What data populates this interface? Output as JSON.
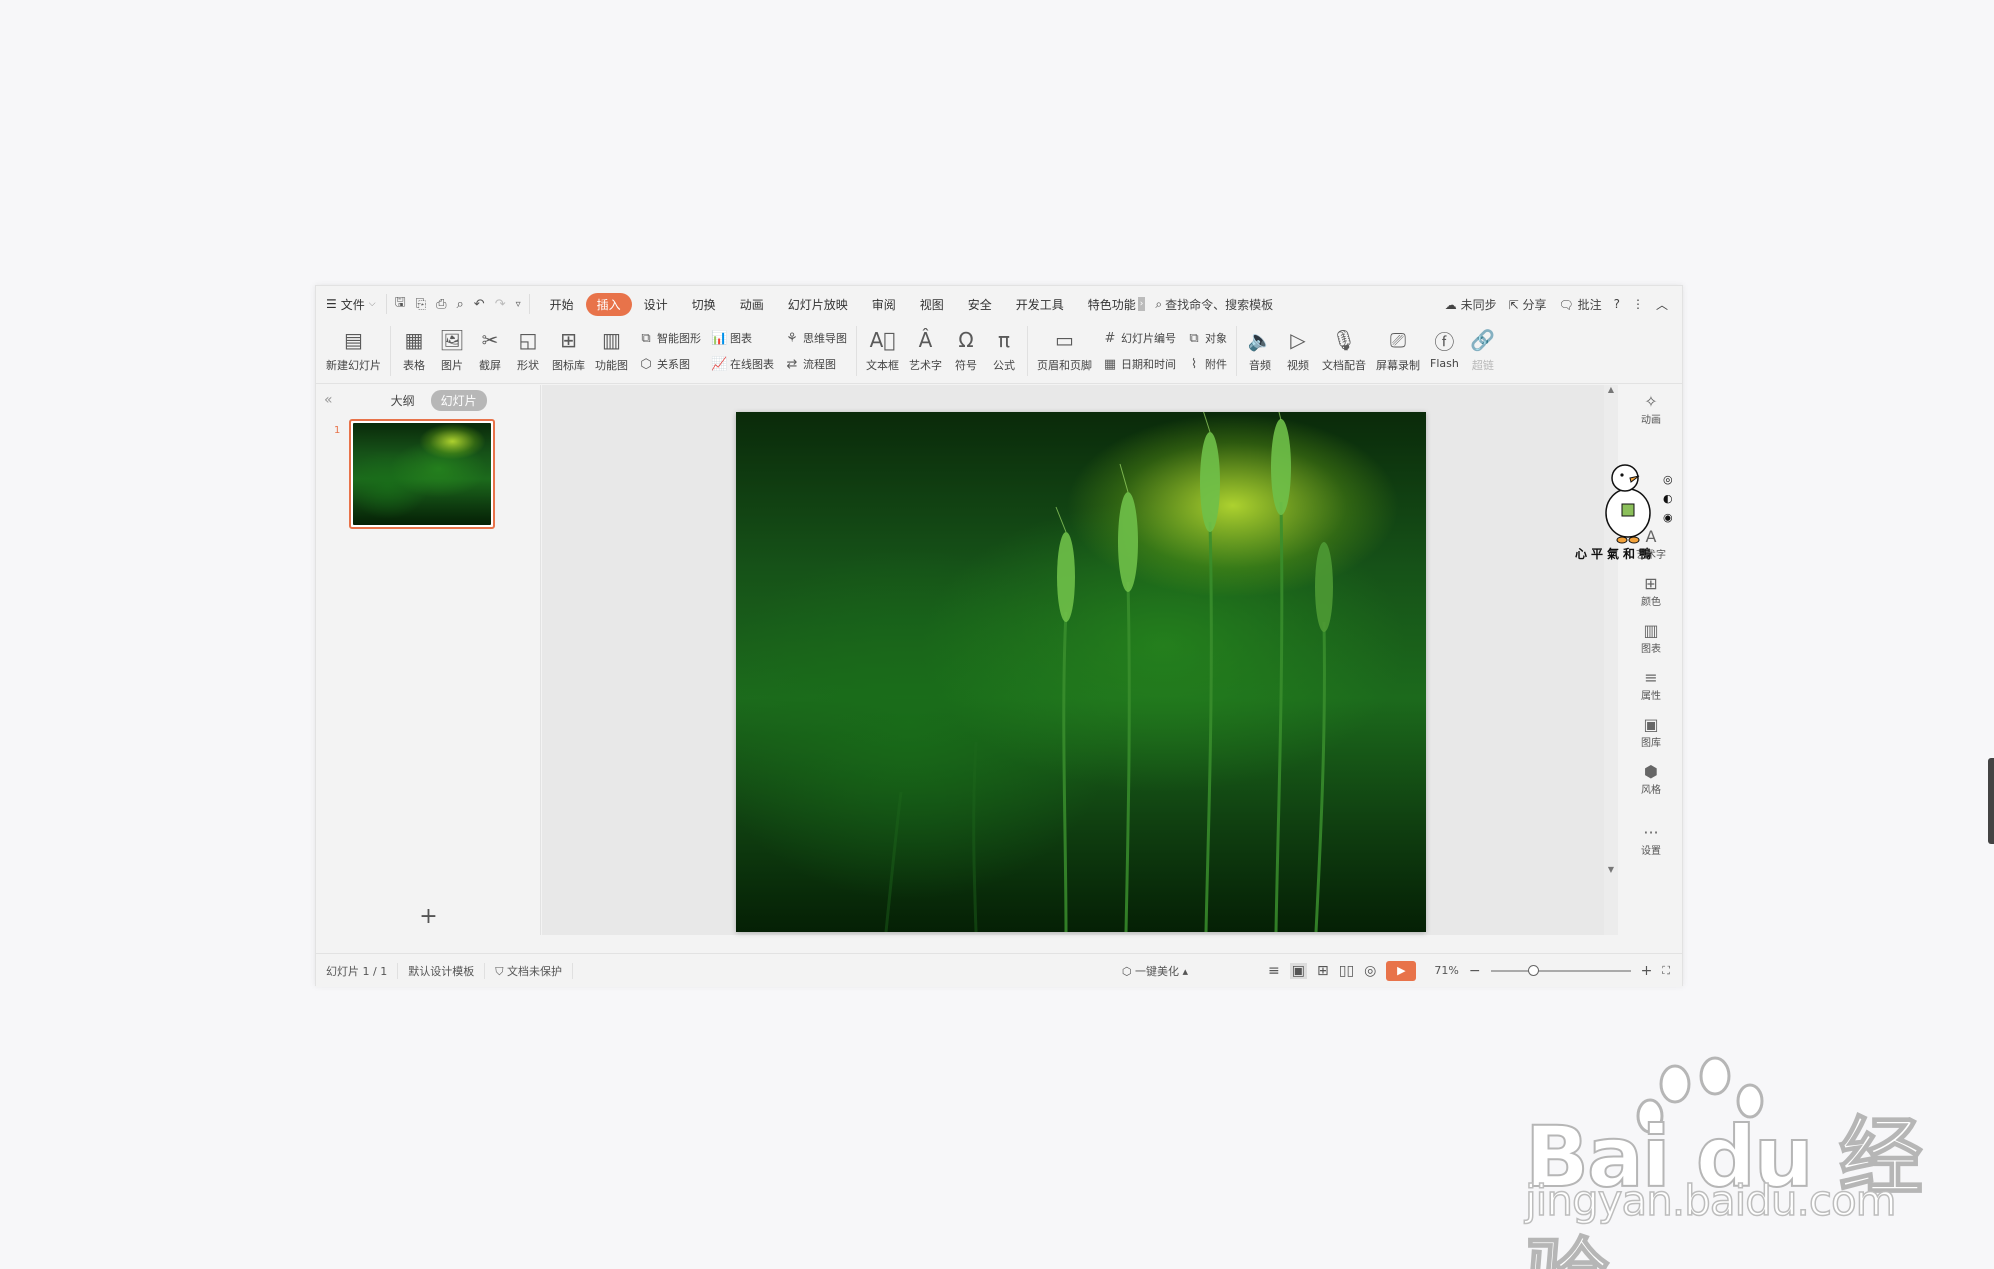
{
  "menubar": {
    "file": "文件",
    "tabs": [
      "开始",
      "插入",
      "设计",
      "切换",
      "动画",
      "幻灯片放映",
      "审阅",
      "视图",
      "安全",
      "开发工具",
      "特色功能"
    ],
    "active_tab": "插入",
    "search": "查找命令、搜索模板",
    "sync": "未同步",
    "share": "分享",
    "comment": "批注",
    "help": "?"
  },
  "ribbon": {
    "new_slide": "新建幻灯片",
    "table": "表格",
    "picture": "图片",
    "screenshot": "截屏",
    "shape": "形状",
    "icon_lib": "图标库",
    "func_chart": "功能图",
    "smart_art": "智能图形",
    "relation": "关系图",
    "chart": "图表",
    "online_chart": "在线图表",
    "mind_map": "思维导图",
    "flow_chart": "流程图",
    "textbox": "文本框",
    "wordart": "艺术字",
    "symbol": "符号",
    "formula": "公式",
    "header_footer": "页眉和页脚",
    "slide_number": "幻灯片编号",
    "date_time": "日期和时间",
    "object": "对象",
    "attachment": "附件",
    "audio": "音频",
    "video": "视频",
    "doc_voice": "文档配音",
    "screen_record": "屏幕录制",
    "flash": "Flash",
    "hyperlink": "超链"
  },
  "left_pane": {
    "tab_outline": "大纲",
    "tab_slides": "幻灯片",
    "slide_number": "1",
    "add": "+"
  },
  "sidebar": {
    "items": [
      "动画",
      "艺术字",
      "颜色",
      "图表",
      "属性",
      "图库",
      "风格",
      "设置"
    ]
  },
  "status": {
    "slide_info": "幻灯片 1 / 1",
    "template": "默认设计模板",
    "protection": "文档未保护",
    "beautify": "一键美化",
    "zoom": "71%",
    "zoom_level": 0.3
  },
  "mascot": {
    "caption": "心平氣和鴨"
  },
  "watermark": {
    "logo": "Bai du 经验",
    "url": "jingyan.baidu.com"
  },
  "colors": {
    "accent": "#e8734a",
    "photo_dark": "#0a2a0a",
    "photo_light": "#b8dc3a"
  }
}
